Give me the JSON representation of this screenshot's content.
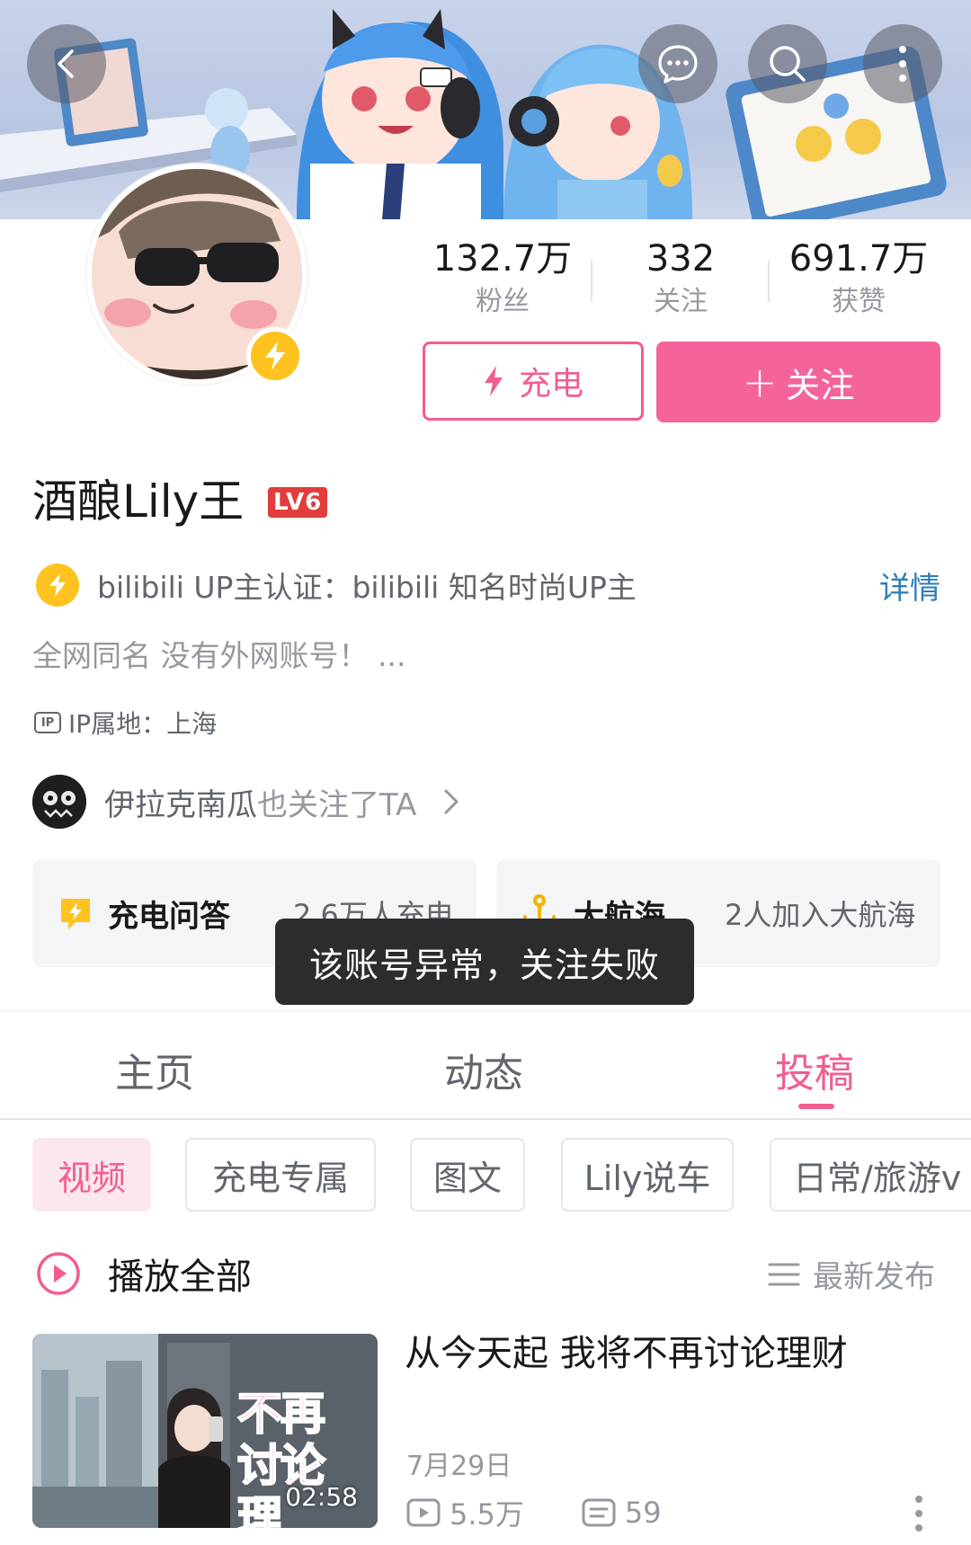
{
  "header": {
    "back_icon": "chevron-left-icon",
    "message_icon": "chat-bubble-icon",
    "search_icon": "search-icon",
    "more_icon": "more-vertical-icon"
  },
  "profile": {
    "stats": [
      {
        "value": "132.7万",
        "label": "粉丝"
      },
      {
        "value": "332",
        "label": "关注"
      },
      {
        "value": "691.7万",
        "label": "获赞"
      }
    ],
    "charge_button": "充电",
    "follow_button": "关注",
    "follow_plus": "+",
    "name": "酒酿Lily王",
    "level": "LV6",
    "verification": "bilibili UP主认证：bilibili 知名时尚UP主",
    "detail_link": "详情",
    "bio": "全网同名 没有外网账号！ ...",
    "ip_tag": "IP",
    "ip_location": "IP属地：上海",
    "mutual_name": "伊拉克南瓜",
    "mutual_suffix": "也关注了TA"
  },
  "cards": {
    "charge_qa_title": "充电问答",
    "charge_qa_count": "2.6万人充电",
    "guard_title": "大航海",
    "guard_count": "2人加入大航海"
  },
  "toast": "该账号异常，关注失败",
  "tabs": [
    "主页",
    "动态",
    "投稿"
  ],
  "active_tab": "投稿",
  "chips": [
    "视频",
    "充电专属",
    "图文",
    "Lily说车",
    "日常/旅游v"
  ],
  "list_header": {
    "play_all": "播放全部",
    "sort": "最新发布"
  },
  "videos": [
    {
      "title": "从今天起 我将不再讨论理财",
      "date": "7月29日",
      "views": "5.5万",
      "comments": "59",
      "duration": "02:58",
      "thumb_text": "不再讨论理"
    }
  ],
  "colors": {
    "accent": "#f25d8e",
    "follow_bg": "#f4649a",
    "badge_yellow": "#ffc21f",
    "link_blue": "#2e7fb8"
  }
}
